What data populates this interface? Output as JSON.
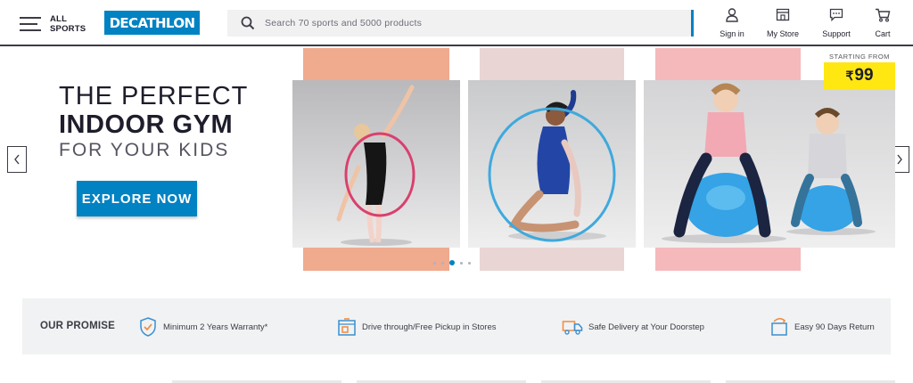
{
  "header": {
    "menu_label": "ALL SPORTS",
    "logo_text": "DECATHLON",
    "search_placeholder": "Search 70 sports and 5000 products",
    "actions": [
      {
        "label": "Sign in",
        "icon": "user-icon"
      },
      {
        "label": "My Store",
        "icon": "store-icon"
      },
      {
        "label": "Support",
        "icon": "support-icon"
      },
      {
        "label": "Cart",
        "icon": "cart-icon"
      }
    ]
  },
  "hero": {
    "line1": "THE PERFECT",
    "line2": "INDOOR GYM",
    "line3": "FOR YOUR KIDS",
    "cta": "EXPLORE NOW",
    "price_prefix": "STARTING FROM",
    "price_currency": "₹",
    "price_value": "99",
    "slides_total": 5,
    "active_slide": 3
  },
  "promise": {
    "title": "OUR PROMISE",
    "items": [
      {
        "text": "Minimum 2 Years Warranty*",
        "icon": "shield-check-icon"
      },
      {
        "text": "Drive through/Free Pickup in Stores",
        "icon": "store-pickup-icon"
      },
      {
        "text": "Safe Delivery at Your Doorstep",
        "icon": "delivery-truck-icon"
      },
      {
        "text": "Easy 90 Days Return",
        "icon": "return-box-icon"
      }
    ]
  },
  "colors": {
    "brand_blue": "#0082c3",
    "price_yellow": "#ffe712",
    "peach": "#f0aa8e",
    "pale_pink": "#ead5d5",
    "pink": "#f5b9bc"
  }
}
